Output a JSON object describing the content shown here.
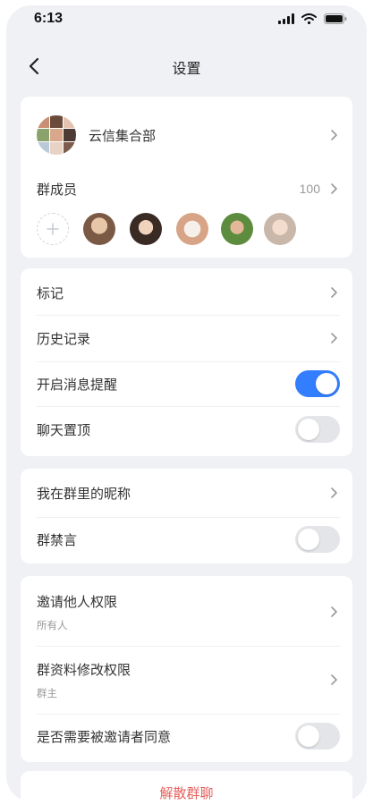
{
  "status_bar": {
    "time": "6:13"
  },
  "nav": {
    "title": "设置"
  },
  "group": {
    "name": "云信集合部",
    "members_label": "群成员",
    "member_count": "100"
  },
  "section2": {
    "tag": "标记",
    "history": "历史记录",
    "notify": {
      "label": "开启消息提醒",
      "on": true
    },
    "pin": {
      "label": "聊天置顶",
      "on": false
    }
  },
  "section3": {
    "nickname": "我在群里的昵称",
    "mute": {
      "label": "群禁言",
      "on": false
    }
  },
  "section4": {
    "invite_permission": {
      "label": "邀请他人权限",
      "value": "所有人"
    },
    "edit_permission": {
      "label": "群资料修改权限",
      "value": "群主"
    },
    "invite_consent": {
      "label": "是否需要被邀请者同意",
      "on": false
    }
  },
  "danger": {
    "dissolve": "解散群聊"
  },
  "colors": {
    "accent": "#337eff",
    "danger": "#e6605c",
    "background": "#eff1f4"
  }
}
